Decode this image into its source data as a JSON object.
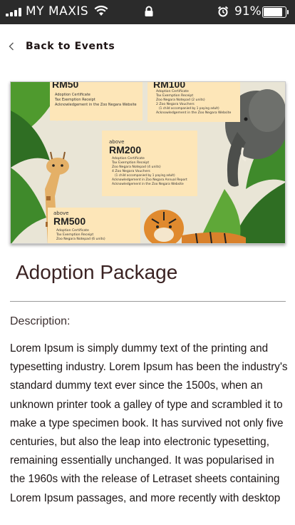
{
  "status_bar": {
    "carrier": "MY MAXIS",
    "battery_percent_label": "91%",
    "battery_level": 0.91,
    "icons": [
      "signal-icon",
      "wifi-icon",
      "lock-icon",
      "alarm-icon",
      "battery-icon"
    ]
  },
  "nav": {
    "back_label": "Back to Events"
  },
  "hero": {
    "tiers": [
      {
        "price": "RM50",
        "items": [
          "Adoption Certificate",
          "Tax Exemption Receipt",
          "Acknowledgement in the Zoo Negara Website"
        ]
      },
      {
        "price": "RM100",
        "items": [
          "Adoption Certificate",
          "Tax Exemption Receipt",
          "Zoo Negara Notepad (2 units)",
          "2 Zoo Negara Vouchers",
          "(1 child accompanied by 1 paying adult)",
          "Acknowledgement in the Zoo Negara Website"
        ]
      },
      {
        "above": "above",
        "price": "RM200",
        "items": [
          "Adoption Certificate",
          "Tax Exemption Receipt",
          "Zoo Negara Notepad (4 units)",
          "4 Zoo Negara Vouchers",
          "(1 child accompanied by 1 paying adult)",
          "Acknowledgement in Zoo Negara Annual Report",
          "Acknowledgement in the Zoo Negara Website"
        ]
      },
      {
        "above": "above",
        "price": "RM500",
        "items": [
          "Adoption Certificate",
          "Tax Exemption Receipt",
          "Zoo Negara Notepad (6 units)"
        ]
      }
    ]
  },
  "page": {
    "title": "Adoption Package",
    "description_label": "Description:",
    "description_text": "Lorem Ipsum is simply dummy text of the printing and typesetting industry. Lorem Ipsum has been the industry's standard dummy text ever since the 1500s, when an unknown printer took a galley of type and scrambled it to make a type specimen book. It has survived not only five centuries, but also the leap into electronic typesetting, remaining essentially unchanged. It was popularised in the 1960s with the release of Letraset sheets containing Lorem Ipsum passages, and more recently with desktop"
  },
  "colors": {
    "status_bar_bg": "#2b2b2b",
    "card_paper": "#fde6b8",
    "leaf_green": "#3f8a2b",
    "title_text": "#3a2222"
  }
}
